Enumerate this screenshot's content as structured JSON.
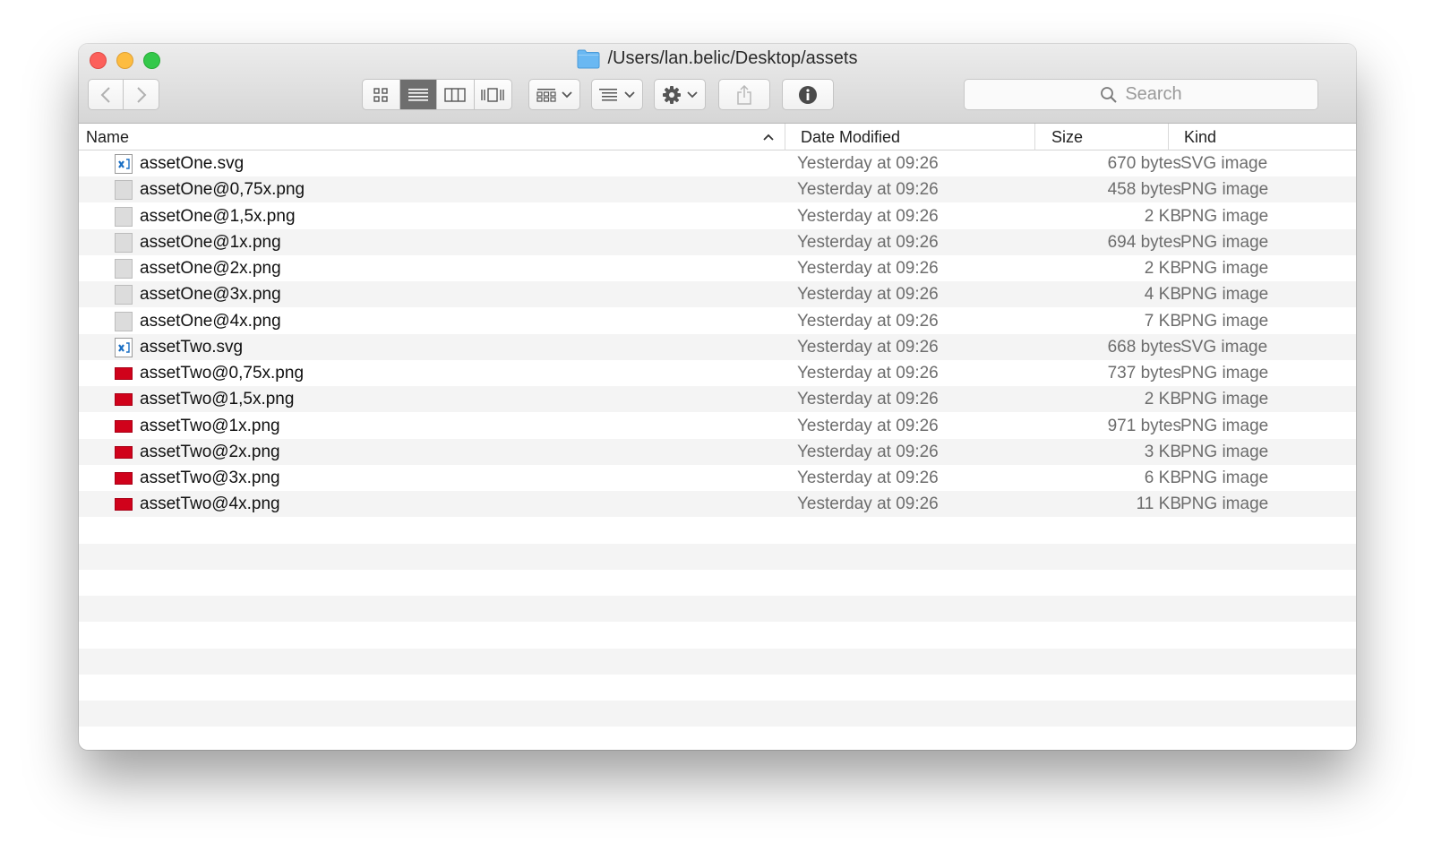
{
  "window": {
    "path": "/Users/lan.belic/Desktop/assets"
  },
  "toolbar": {
    "back_icon": "chevron-left-icon",
    "forward_icon": "chevron-right-icon",
    "view_modes": [
      "icon-view-icon",
      "list-view-icon",
      "column-view-icon",
      "cover-flow-icon"
    ],
    "active_view": "list",
    "group_icon": "group-by-icon",
    "arrange_icon": "arrange-icon",
    "action_icon": "gear-icon",
    "share_icon": "share-icon",
    "info_icon": "info-icon",
    "search_placeholder": "Search"
  },
  "columns": {
    "name": "Name",
    "date": "Date Modified",
    "size": "Size",
    "kind": "Kind",
    "sort": "name-ascending"
  },
  "files": [
    {
      "name": "assetOne.svg",
      "date": "Yesterday at 09:26",
      "size": "670 bytes",
      "kind": "SVG image",
      "icon": "svg"
    },
    {
      "name": "assetOne@0,75x.png",
      "date": "Yesterday at 09:26",
      "size": "458 bytes",
      "kind": "PNG image",
      "icon": "png-gray"
    },
    {
      "name": "assetOne@1,5x.png",
      "date": "Yesterday at 09:26",
      "size": "2 KB",
      "kind": "PNG image",
      "icon": "png-gray"
    },
    {
      "name": "assetOne@1x.png",
      "date": "Yesterday at 09:26",
      "size": "694 bytes",
      "kind": "PNG image",
      "icon": "png-gray"
    },
    {
      "name": "assetOne@2x.png",
      "date": "Yesterday at 09:26",
      "size": "2 KB",
      "kind": "PNG image",
      "icon": "png-gray"
    },
    {
      "name": "assetOne@3x.png",
      "date": "Yesterday at 09:26",
      "size": "4 KB",
      "kind": "PNG image",
      "icon": "png-gray"
    },
    {
      "name": "assetOne@4x.png",
      "date": "Yesterday at 09:26",
      "size": "7 KB",
      "kind": "PNG image",
      "icon": "png-gray"
    },
    {
      "name": "assetTwo.svg",
      "date": "Yesterday at 09:26",
      "size": "668 bytes",
      "kind": "SVG image",
      "icon": "svg"
    },
    {
      "name": "assetTwo@0,75x.png",
      "date": "Yesterday at 09:26",
      "size": "737 bytes",
      "kind": "PNG image",
      "icon": "png-red"
    },
    {
      "name": "assetTwo@1,5x.png",
      "date": "Yesterday at 09:26",
      "size": "2 KB",
      "kind": "PNG image",
      "icon": "png-red"
    },
    {
      "name": "assetTwo@1x.png",
      "date": "Yesterday at 09:26",
      "size": "971 bytes",
      "kind": "PNG image",
      "icon": "png-red"
    },
    {
      "name": "assetTwo@2x.png",
      "date": "Yesterday at 09:26",
      "size": "3 KB",
      "kind": "PNG image",
      "icon": "png-red"
    },
    {
      "name": "assetTwo@3x.png",
      "date": "Yesterday at 09:26",
      "size": "6 KB",
      "kind": "PNG image",
      "icon": "png-red"
    },
    {
      "name": "assetTwo@4x.png",
      "date": "Yesterday at 09:26",
      "size": "11 KB",
      "kind": "PNG image",
      "icon": "png-red"
    }
  ],
  "colors": {
    "close": "#fc605b",
    "minimize": "#fdbc40",
    "zoom": "#34c84a",
    "folder": "#6ab8f2",
    "png_red": "#d0021b",
    "row_alt": "#f4f4f4"
  }
}
